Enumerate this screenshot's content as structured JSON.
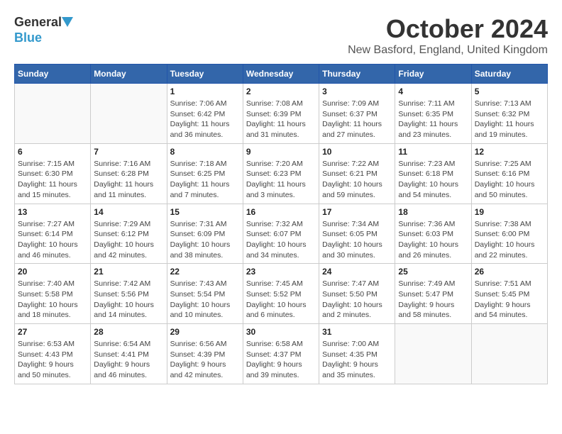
{
  "header": {
    "logo_general": "General",
    "logo_blue": "Blue",
    "month": "October 2024",
    "location": "New Basford, England, United Kingdom"
  },
  "weekdays": [
    "Sunday",
    "Monday",
    "Tuesday",
    "Wednesday",
    "Thursday",
    "Friday",
    "Saturday"
  ],
  "weeks": [
    [
      {
        "day": "",
        "info": ""
      },
      {
        "day": "",
        "info": ""
      },
      {
        "day": "1",
        "info": "Sunrise: 7:06 AM\nSunset: 6:42 PM\nDaylight: 11 hours and 36 minutes."
      },
      {
        "day": "2",
        "info": "Sunrise: 7:08 AM\nSunset: 6:39 PM\nDaylight: 11 hours and 31 minutes."
      },
      {
        "day": "3",
        "info": "Sunrise: 7:09 AM\nSunset: 6:37 PM\nDaylight: 11 hours and 27 minutes."
      },
      {
        "day": "4",
        "info": "Sunrise: 7:11 AM\nSunset: 6:35 PM\nDaylight: 11 hours and 23 minutes."
      },
      {
        "day": "5",
        "info": "Sunrise: 7:13 AM\nSunset: 6:32 PM\nDaylight: 11 hours and 19 minutes."
      }
    ],
    [
      {
        "day": "6",
        "info": "Sunrise: 7:15 AM\nSunset: 6:30 PM\nDaylight: 11 hours and 15 minutes."
      },
      {
        "day": "7",
        "info": "Sunrise: 7:16 AM\nSunset: 6:28 PM\nDaylight: 11 hours and 11 minutes."
      },
      {
        "day": "8",
        "info": "Sunrise: 7:18 AM\nSunset: 6:25 PM\nDaylight: 11 hours and 7 minutes."
      },
      {
        "day": "9",
        "info": "Sunrise: 7:20 AM\nSunset: 6:23 PM\nDaylight: 11 hours and 3 minutes."
      },
      {
        "day": "10",
        "info": "Sunrise: 7:22 AM\nSunset: 6:21 PM\nDaylight: 10 hours and 59 minutes."
      },
      {
        "day": "11",
        "info": "Sunrise: 7:23 AM\nSunset: 6:18 PM\nDaylight: 10 hours and 54 minutes."
      },
      {
        "day": "12",
        "info": "Sunrise: 7:25 AM\nSunset: 6:16 PM\nDaylight: 10 hours and 50 minutes."
      }
    ],
    [
      {
        "day": "13",
        "info": "Sunrise: 7:27 AM\nSunset: 6:14 PM\nDaylight: 10 hours and 46 minutes."
      },
      {
        "day": "14",
        "info": "Sunrise: 7:29 AM\nSunset: 6:12 PM\nDaylight: 10 hours and 42 minutes."
      },
      {
        "day": "15",
        "info": "Sunrise: 7:31 AM\nSunset: 6:09 PM\nDaylight: 10 hours and 38 minutes."
      },
      {
        "day": "16",
        "info": "Sunrise: 7:32 AM\nSunset: 6:07 PM\nDaylight: 10 hours and 34 minutes."
      },
      {
        "day": "17",
        "info": "Sunrise: 7:34 AM\nSunset: 6:05 PM\nDaylight: 10 hours and 30 minutes."
      },
      {
        "day": "18",
        "info": "Sunrise: 7:36 AM\nSunset: 6:03 PM\nDaylight: 10 hours and 26 minutes."
      },
      {
        "day": "19",
        "info": "Sunrise: 7:38 AM\nSunset: 6:00 PM\nDaylight: 10 hours and 22 minutes."
      }
    ],
    [
      {
        "day": "20",
        "info": "Sunrise: 7:40 AM\nSunset: 5:58 PM\nDaylight: 10 hours and 18 minutes."
      },
      {
        "day": "21",
        "info": "Sunrise: 7:42 AM\nSunset: 5:56 PM\nDaylight: 10 hours and 14 minutes."
      },
      {
        "day": "22",
        "info": "Sunrise: 7:43 AM\nSunset: 5:54 PM\nDaylight: 10 hours and 10 minutes."
      },
      {
        "day": "23",
        "info": "Sunrise: 7:45 AM\nSunset: 5:52 PM\nDaylight: 10 hours and 6 minutes."
      },
      {
        "day": "24",
        "info": "Sunrise: 7:47 AM\nSunset: 5:50 PM\nDaylight: 10 hours and 2 minutes."
      },
      {
        "day": "25",
        "info": "Sunrise: 7:49 AM\nSunset: 5:47 PM\nDaylight: 9 hours and 58 minutes."
      },
      {
        "day": "26",
        "info": "Sunrise: 7:51 AM\nSunset: 5:45 PM\nDaylight: 9 hours and 54 minutes."
      }
    ],
    [
      {
        "day": "27",
        "info": "Sunrise: 6:53 AM\nSunset: 4:43 PM\nDaylight: 9 hours and 50 minutes."
      },
      {
        "day": "28",
        "info": "Sunrise: 6:54 AM\nSunset: 4:41 PM\nDaylight: 9 hours and 46 minutes."
      },
      {
        "day": "29",
        "info": "Sunrise: 6:56 AM\nSunset: 4:39 PM\nDaylight: 9 hours and 42 minutes."
      },
      {
        "day": "30",
        "info": "Sunrise: 6:58 AM\nSunset: 4:37 PM\nDaylight: 9 hours and 39 minutes."
      },
      {
        "day": "31",
        "info": "Sunrise: 7:00 AM\nSunset: 4:35 PM\nDaylight: 9 hours and 35 minutes."
      },
      {
        "day": "",
        "info": ""
      },
      {
        "day": "",
        "info": ""
      }
    ]
  ]
}
